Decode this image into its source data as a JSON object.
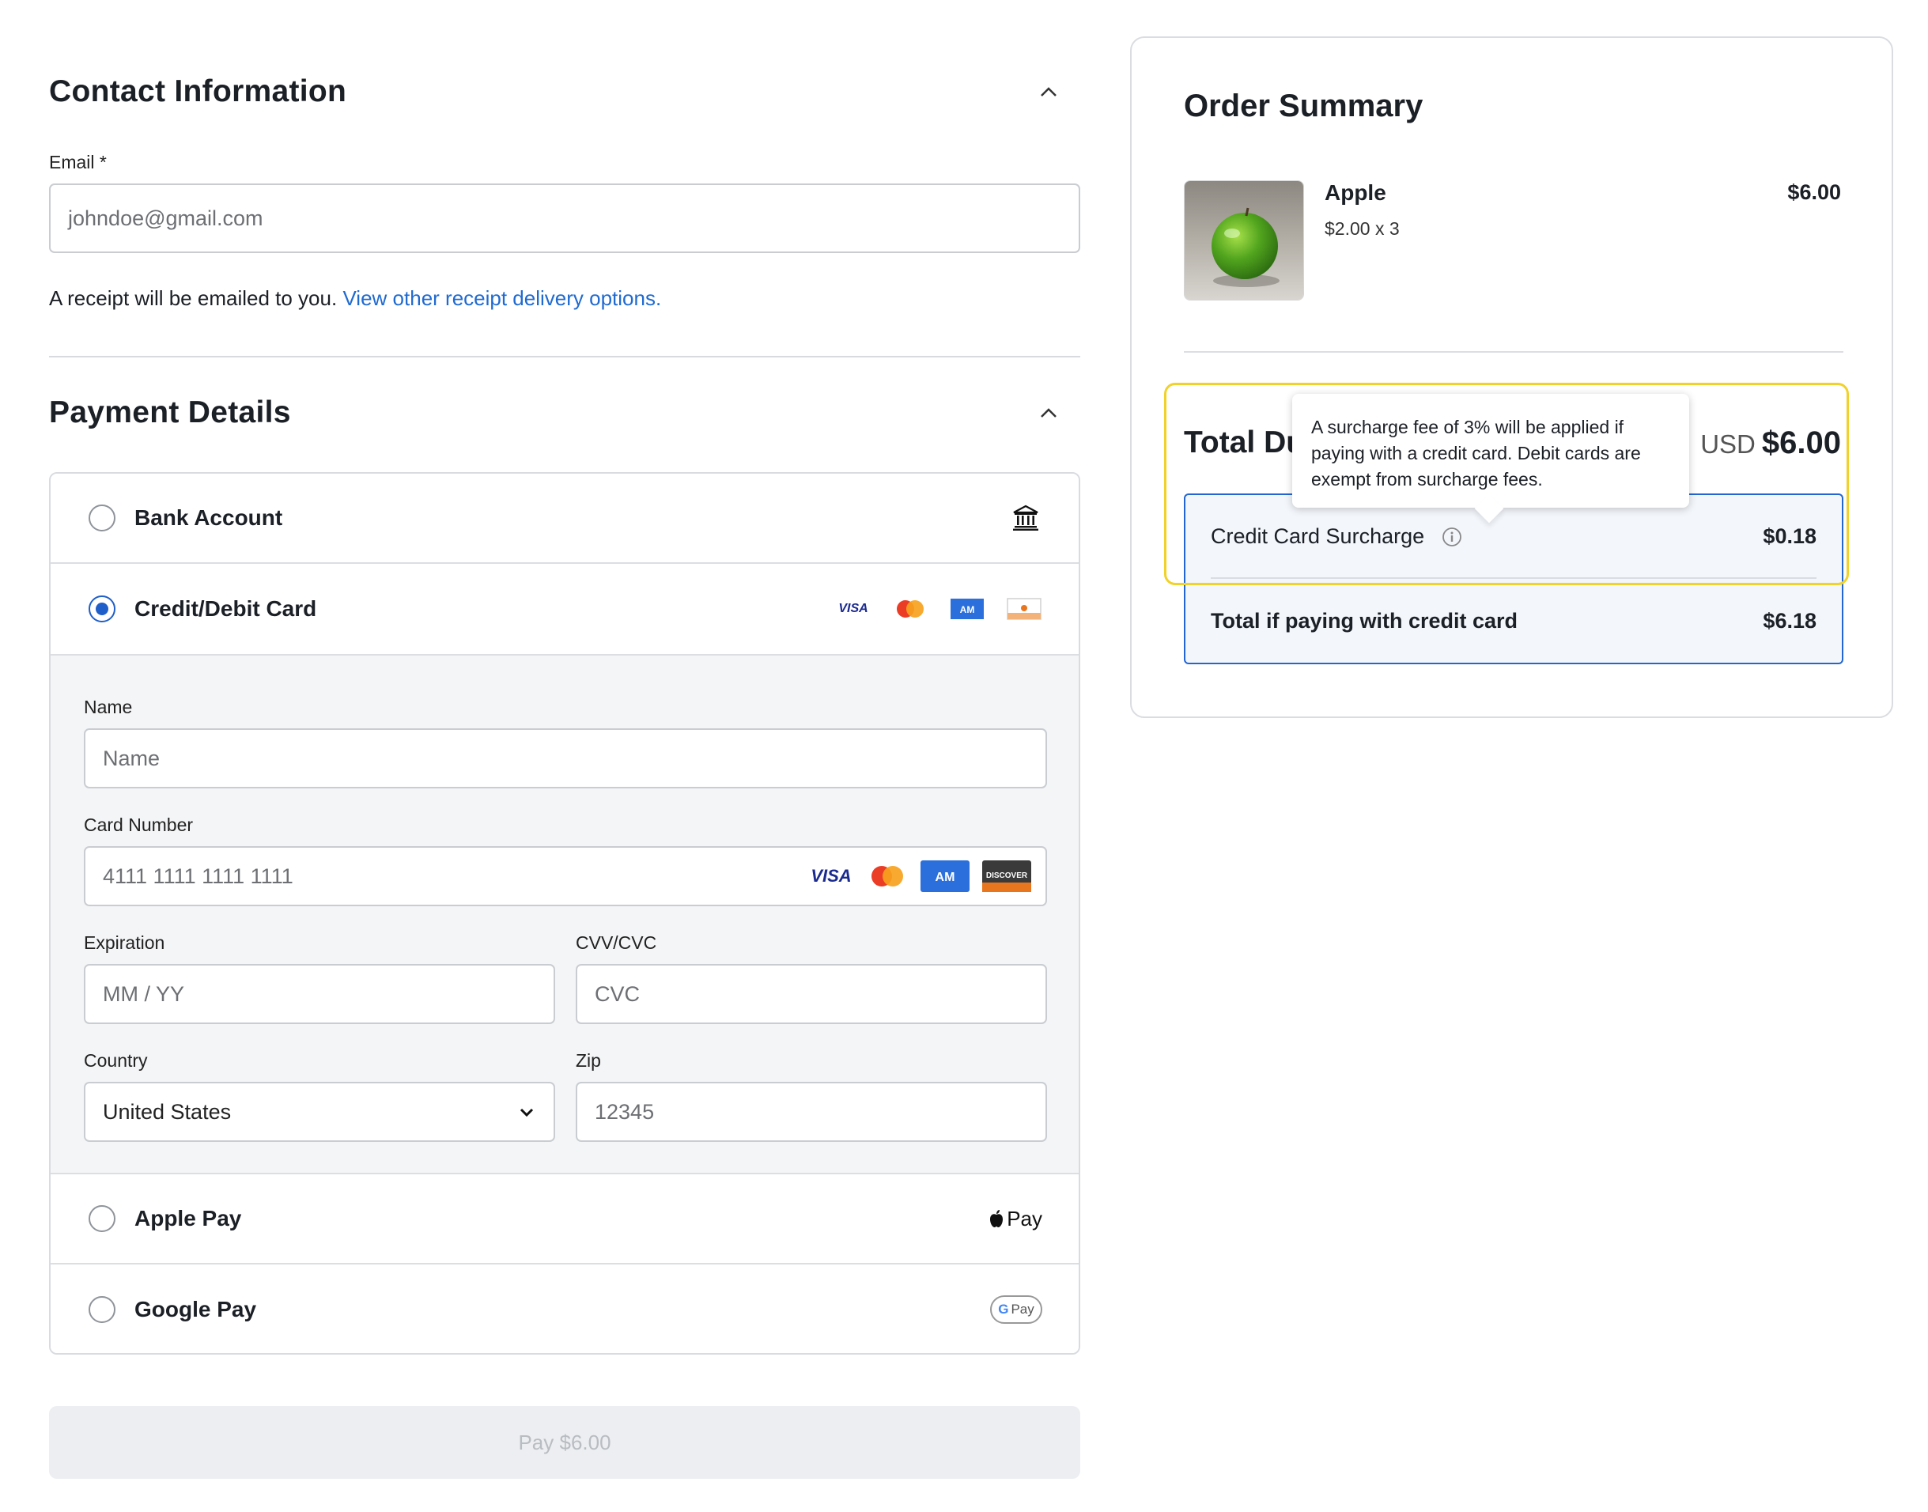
{
  "contact": {
    "title": "Contact Information",
    "email_label": "Email *",
    "email_value": "johndoe@gmail.com",
    "receipt_text": "A receipt will be emailed to you.",
    "receipt_link": "View other receipt delivery options."
  },
  "payment": {
    "title": "Payment Details",
    "methods": [
      {
        "label": "Bank Account",
        "selected": false,
        "icon": "bank-icon"
      },
      {
        "label": "Credit/Debit Card",
        "selected": true,
        "icon": "card-brands"
      },
      {
        "label": "Apple Pay",
        "selected": false,
        "icon": "apple-pay-icon"
      },
      {
        "label": "Google Pay",
        "selected": false,
        "icon": "google-pay-icon"
      }
    ],
    "card_brands": [
      "VISA",
      "Mastercard",
      "AMEX",
      "DISCOVER"
    ],
    "form": {
      "name_label": "Name",
      "name_placeholder": "Name",
      "card_label": "Card Number",
      "card_placeholder": "4111 1111 1111 1111",
      "exp_label": "Expiration",
      "exp_placeholder": "MM / YY",
      "cvv_label": "CVV/CVC",
      "cvv_placeholder": "CVC",
      "country_label": "Country",
      "country_value": "United States",
      "zip_label": "Zip",
      "zip_placeholder": "12345"
    },
    "apple_pay_badge": "Pay",
    "google_pay_badge": "Pay"
  },
  "pay_button": "Pay $6.00",
  "summary": {
    "title": "Order Summary",
    "item": {
      "name": "Apple",
      "qty": "$2.00 x 3",
      "price": "$6.00"
    },
    "total_due_label": "Total Du",
    "total_due_currency": "USD",
    "total_due_amount": "$6.00",
    "surcharge_label": "Credit Card Surcharge",
    "surcharge_amount": "$0.18",
    "credit_total_label": "Total if paying with credit card",
    "credit_total_amount": "$6.18",
    "tooltip": "A surcharge fee of 3% will be applied if paying with a credit card. Debit cards are exempt from surcharge fees."
  },
  "colors": {
    "accent": "#1f5fc9",
    "link": "#1f6ad1",
    "highlight": "#f0d22a",
    "visa": "#1a2a8f",
    "amex": "#2a6fdb",
    "discover": "#e8761e"
  }
}
